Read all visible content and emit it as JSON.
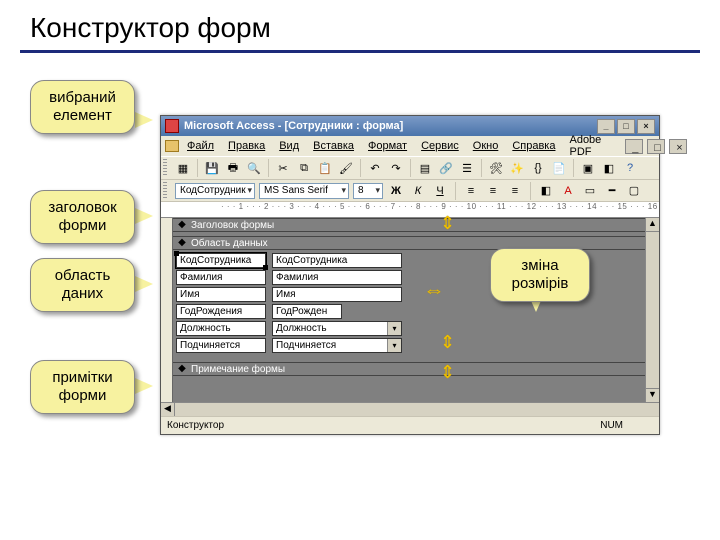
{
  "slide": {
    "title": "Конструктор форм"
  },
  "callouts": {
    "selected_element": "вибраний\nелемент",
    "form_header": "заголовок\nформи",
    "data_area": "область\nданих",
    "form_notes": "примітки\nформи",
    "resize": "зміна\nрозмірів"
  },
  "window": {
    "title": "Microsoft Access - [Сотрудники : форма]",
    "min": "_",
    "max": "□",
    "close": "×",
    "inner_min": "_",
    "inner_max": "□",
    "inner_close": "×"
  },
  "menu": {
    "file": "Файл",
    "edit": "Правка",
    "view": "Вид",
    "insert": "Вставка",
    "format": "Формат",
    "service": "Сервис",
    "window": "Окно",
    "help": "Справка",
    "adobe": "Adobe PDF"
  },
  "format": {
    "object": "КодСотрудник",
    "font": "MS Sans Serif",
    "size": "8",
    "bold": "Ж",
    "italic": "К",
    "underline": "Ч"
  },
  "ruler": "· · · 1 · · · 2 · · · 3 · · · 4 · · · 5 · · · 6 · · · 7 · · · 8 · · · 9 · · · 10 · · · 11 · · · 12 · · · 13 · · · 14 · · · 15 · · · 16",
  "sections": {
    "header": "Заголовок формы",
    "detail": "Область данных",
    "footer": "Примечание формы"
  },
  "fields": [
    {
      "label": "КодСотрудника",
      "control": "КодСотрудника",
      "type": "text",
      "selected": true
    },
    {
      "label": "Фамилия",
      "control": "Фамилия",
      "type": "text"
    },
    {
      "label": "Имя",
      "control": "Имя",
      "type": "text"
    },
    {
      "label": "ГодРождения",
      "control": "ГодРожден",
      "type": "text_short"
    },
    {
      "label": "Должность",
      "control": "Должность",
      "type": "combo"
    },
    {
      "label": "Подчиняется",
      "control": "Подчиняется",
      "type": "combo"
    }
  ],
  "status": {
    "mode": "Конструктор",
    "num": "NUM"
  }
}
